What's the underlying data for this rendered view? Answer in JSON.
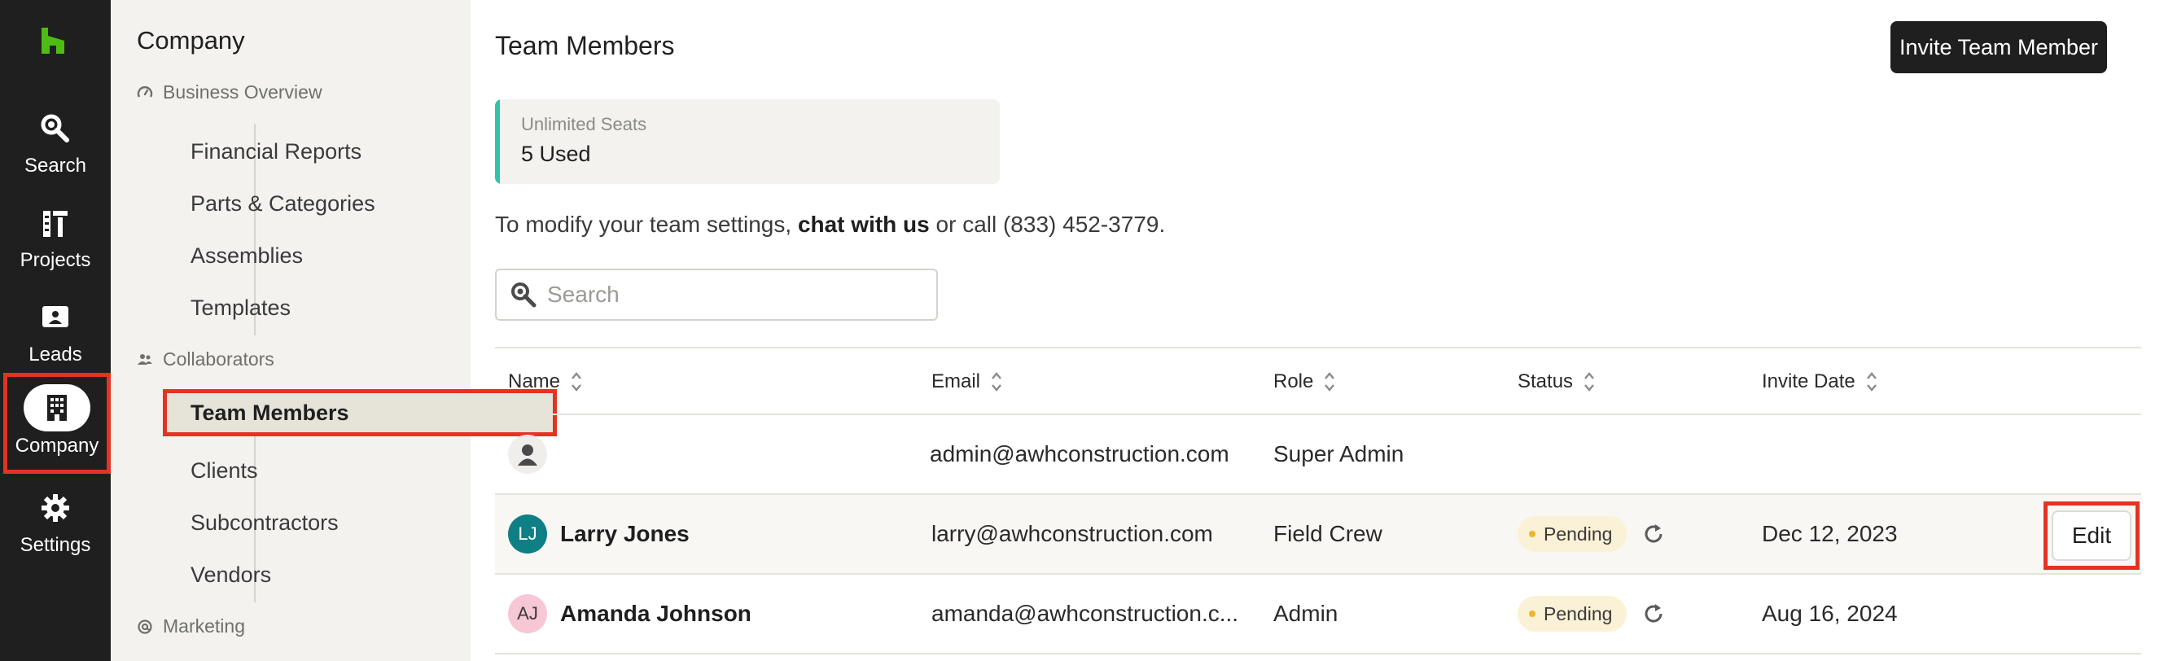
{
  "rail": {
    "logo_icon": "houzz-logo-icon",
    "accent_color": "#4dbc15",
    "items": [
      {
        "label": "Search",
        "icon": "search-icon"
      },
      {
        "label": "Projects",
        "icon": "projects-icon"
      },
      {
        "label": "Leads",
        "icon": "leads-icon"
      },
      {
        "label": "Company",
        "icon": "building-icon"
      },
      {
        "label": "Settings",
        "icon": "gear-icon"
      }
    ],
    "active": "Company"
  },
  "sidebar": {
    "title": "Company",
    "sections": [
      {
        "label": "Business Overview",
        "icon": "gauge-icon"
      },
      {
        "label": "Collaborators",
        "icon": "people-icon"
      },
      {
        "label": "Marketing",
        "icon": "at-icon"
      }
    ],
    "business_items": [
      "Financial Reports",
      "Parts & Categories",
      "Assemblies",
      "Templates"
    ],
    "collaborator_items": [
      "Team Members",
      "Clients",
      "Subcontractors",
      "Vendors"
    ],
    "active_item": "Team Members"
  },
  "main": {
    "title": "Team Members",
    "invite_button": "Invite Team Member",
    "seats": {
      "label": "Unlimited Seats",
      "value": "5 Used",
      "accent_color": "#2fc4a7"
    },
    "modify": {
      "prefix": "To modify your team settings, ",
      "link": "chat with us",
      "suffix": " or call (833) 452-3779."
    },
    "search": {
      "placeholder": "Search",
      "value": ""
    },
    "table": {
      "columns": [
        "Name",
        "Email",
        "Role",
        "Status",
        "Invite Date"
      ],
      "rows": [
        {
          "initials": "",
          "name": "",
          "email": "admin@awhconstruction.com",
          "role": "Super Admin",
          "status": "",
          "invite_date": "",
          "avatar_bg": "#efeeea"
        },
        {
          "initials": "LJ",
          "name": "Larry Jones",
          "email": "larry@awhconstruction.com",
          "role": "Field Crew",
          "status": "Pending",
          "invite_date": "Dec 12, 2023",
          "avatar_bg": "#0f7f86",
          "action": "Edit"
        },
        {
          "initials": "AJ",
          "name": "Amanda Johnson",
          "email": "amanda@awhconstruction.c...",
          "role": "Admin",
          "status": "Pending",
          "invite_date": "Aug 16, 2024",
          "avatar_bg": "#f7c7d6"
        }
      ]
    }
  }
}
